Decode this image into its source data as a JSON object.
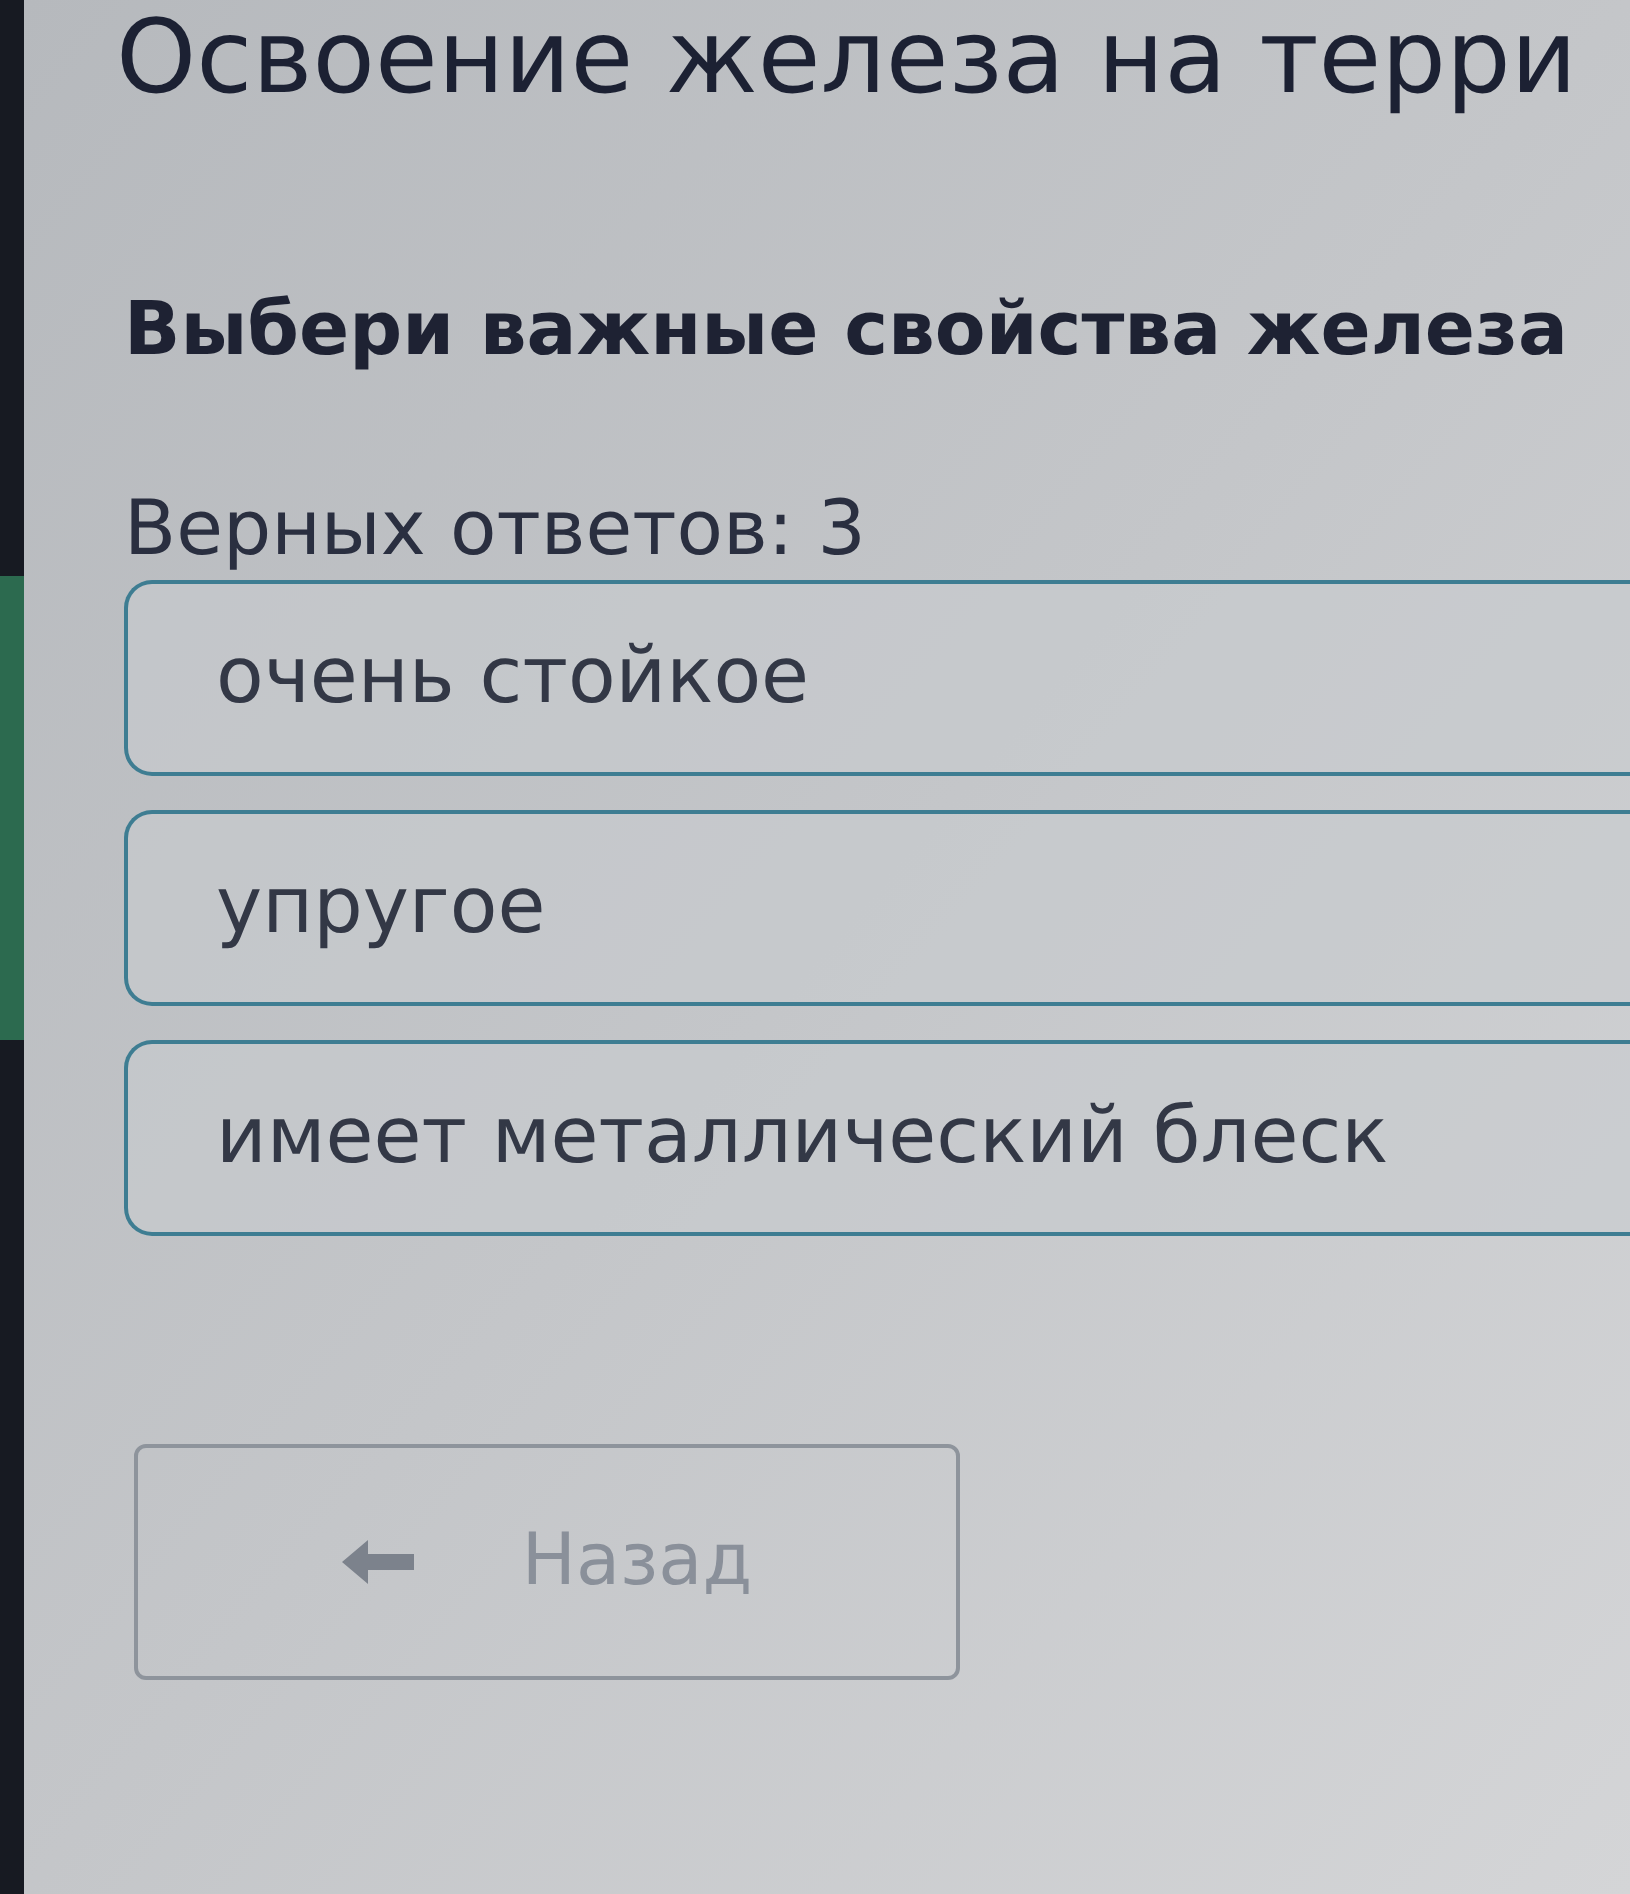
{
  "header": {
    "title": "Освоение железа на терри"
  },
  "question": {
    "prompt": "Выбери важные свойства железа",
    "answer_count": "Верных ответов: 3"
  },
  "options": [
    {
      "label": "очень стойкое",
      "selected": false
    },
    {
      "label": "упругое",
      "selected": false
    },
    {
      "label": "имеет металлический блеск",
      "selected": false
    }
  ],
  "back_button": {
    "label": "Назад",
    "disabled": true
  }
}
